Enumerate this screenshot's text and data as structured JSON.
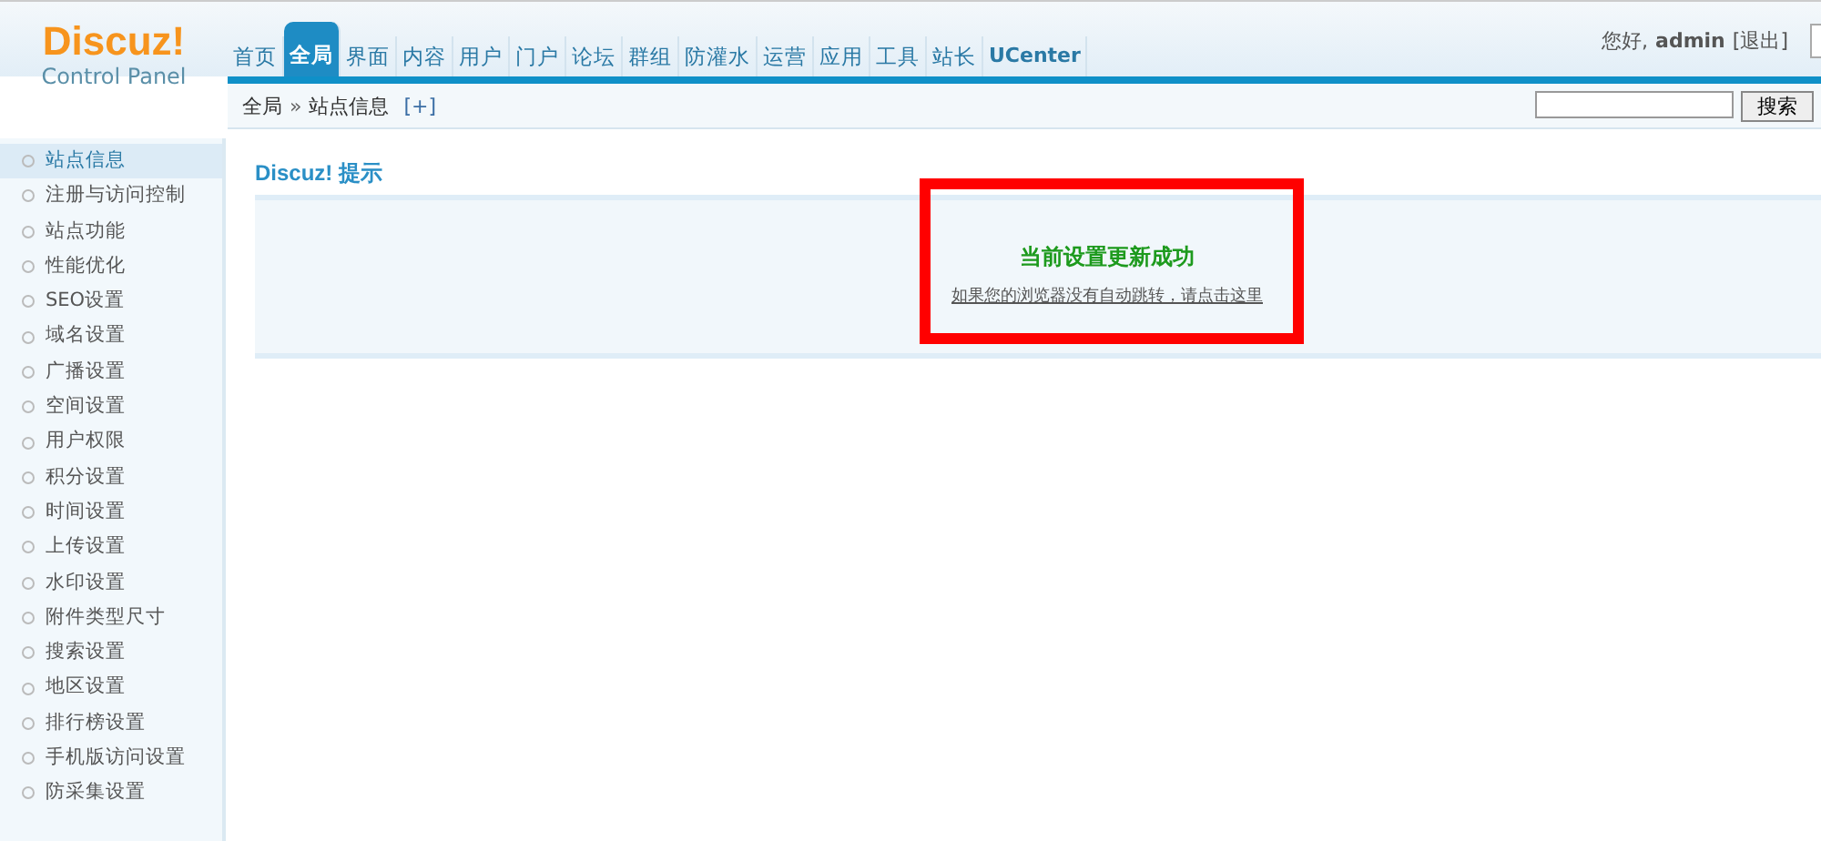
{
  "logo": {
    "name": "Discuz!",
    "subtitle": "Control Panel"
  },
  "nav": [
    {
      "label": "首页",
      "selected": false
    },
    {
      "label": "全局",
      "selected": true
    },
    {
      "label": "界面",
      "selected": false
    },
    {
      "label": "内容",
      "selected": false
    },
    {
      "label": "用户",
      "selected": false
    },
    {
      "label": "门户",
      "selected": false
    },
    {
      "label": "论坛",
      "selected": false
    },
    {
      "label": "群组",
      "selected": false
    },
    {
      "label": "防灌水",
      "selected": false
    },
    {
      "label": "运营",
      "selected": false
    },
    {
      "label": "应用",
      "selected": false
    },
    {
      "label": "工具",
      "selected": false
    },
    {
      "label": "站长",
      "selected": false
    },
    {
      "label": "UCenter",
      "selected": false
    }
  ],
  "user": {
    "greeting": "您好,",
    "name": "admin",
    "logout": "[退出]"
  },
  "breadcrumb": {
    "items": [
      "全局",
      "站点信息"
    ],
    "separator": "»",
    "add": "[+]"
  },
  "search": {
    "button": "搜索"
  },
  "sidebar": {
    "items": [
      {
        "label": "站点信息",
        "selected": true
      },
      {
        "label": "注册与访问控制",
        "selected": false
      },
      {
        "label": "站点功能",
        "selected": false
      },
      {
        "label": "性能优化",
        "selected": false
      },
      {
        "label": "SEO设置",
        "selected": false
      },
      {
        "label": "域名设置",
        "selected": false
      },
      {
        "label": "广播设置",
        "selected": false
      },
      {
        "label": "空间设置",
        "selected": false
      },
      {
        "label": "用户权限",
        "selected": false
      },
      {
        "label": "积分设置",
        "selected": false
      },
      {
        "label": "时间设置",
        "selected": false
      },
      {
        "label": "上传设置",
        "selected": false
      },
      {
        "label": "水印设置",
        "selected": false
      },
      {
        "label": "附件类型尺寸",
        "selected": false
      },
      {
        "label": "搜索设置",
        "selected": false
      },
      {
        "label": "地区设置",
        "selected": false
      },
      {
        "label": "排行榜设置",
        "selected": false
      },
      {
        "label": "手机版访问设置",
        "selected": false
      },
      {
        "label": "防采集设置",
        "selected": false
      }
    ]
  },
  "notice": {
    "title": "Discuz! 提示",
    "message": "当前设置更新成功",
    "link": "如果您的浏览器没有自动跳转，请点击这里"
  }
}
